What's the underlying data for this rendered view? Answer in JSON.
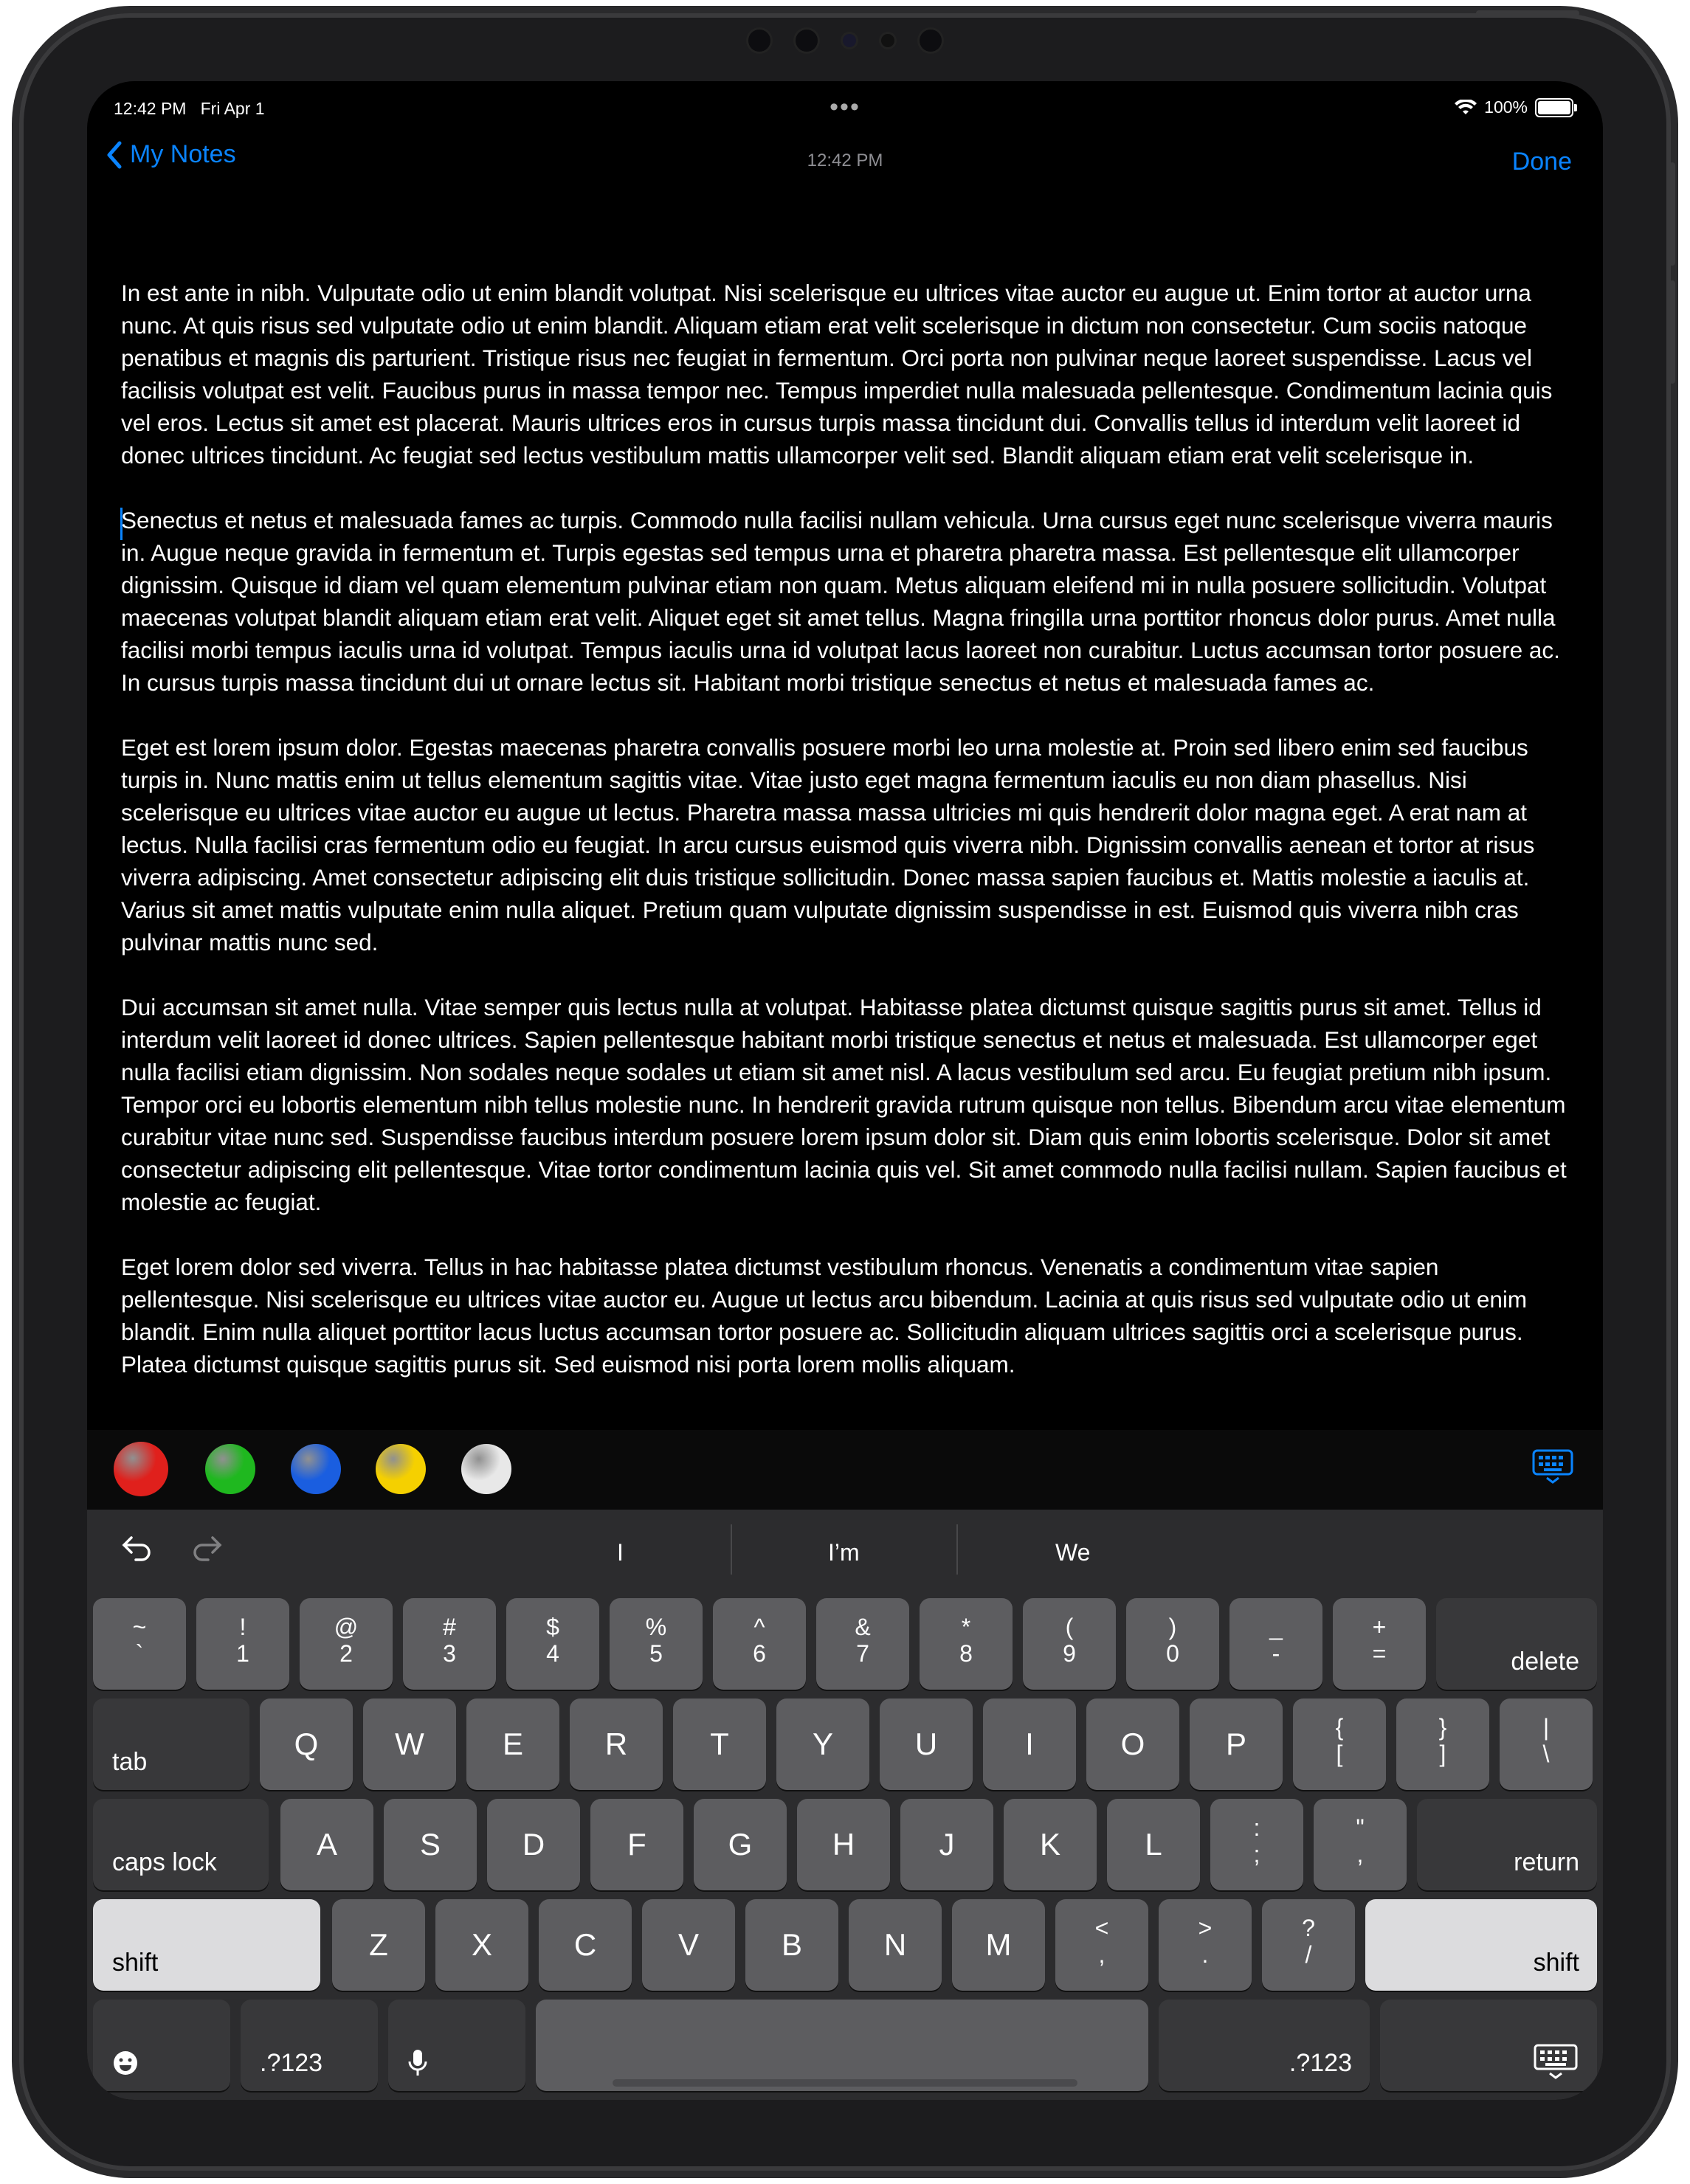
{
  "status_bar": {
    "time": "12:42 PM",
    "date": "Fri Apr 1",
    "battery": "100%",
    "icons": [
      "wifi-icon",
      "battery-icon"
    ]
  },
  "nav": {
    "back_label": "My Notes",
    "center_time": "12:42 PM",
    "done_label": "Done"
  },
  "note": {
    "paragraphs": [
      "In est ante in nibh. Vulputate odio ut enim blandit volutpat. Nisi scelerisque eu ultrices vitae auctor eu augue ut. Enim tortor at auctor urna nunc. At quis risus sed vulputate odio ut enim blandit. Aliquam etiam erat velit scelerisque in dictum non consectetur. Cum sociis natoque penatibus et magnis dis parturient. Tristique risus nec feugiat in fermentum. Orci porta non pulvinar neque laoreet suspendisse. Lacus vel facilisis volutpat est velit. Faucibus purus in massa tempor nec. Tempus imperdiet nulla malesuada pellentesque. Condimentum lacinia quis vel eros. Lectus sit amet est placerat. Mauris ultrices eros in cursus turpis massa tincidunt dui. Convallis tellus id interdum velit laoreet id donec ultrices tincidunt. Ac feugiat sed lectus vestibulum mattis ullamcorper velit sed. Blandit aliquam etiam erat velit scelerisque in.",
      "Senectus et netus et malesuada fames ac turpis. Commodo nulla facilisi nullam vehicula. Urna cursus eget nunc scelerisque viverra mauris in. Augue neque gravida in fermentum et. Turpis egestas sed tempus urna et pharetra pharetra massa. Est pellentesque elit ullamcorper dignissim. Quisque id diam vel quam elementum pulvinar etiam non quam. Metus aliquam eleifend mi in nulla posuere sollicitudin. Volutpat maecenas volutpat blandit aliquam etiam erat velit. Aliquet eget sit amet tellus. Magna fringilla urna porttitor rhoncus dolor purus. Amet nulla facilisi morbi tempus iaculis urna id volutpat. Tempus iaculis urna id volutpat lacus laoreet non curabitur. Luctus accumsan tortor posuere ac. In cursus turpis massa tincidunt dui ut ornare lectus sit. Habitant morbi tristique senectus et netus et malesuada fames ac.",
      "Eget est lorem ipsum dolor. Egestas maecenas pharetra convallis posuere morbi leo urna molestie at. Proin sed libero enim sed faucibus turpis in. Nunc mattis enim ut tellus elementum sagittis vitae. Vitae justo eget magna fermentum iaculis eu non diam phasellus. Nisi scelerisque eu ultrices vitae auctor eu augue ut lectus. Pharetra massa massa ultricies mi quis hendrerit dolor magna eget. A erat nam at lectus. Nulla facilisi cras fermentum odio eu feugiat. In arcu cursus euismod quis viverra nibh. Dignissim convallis aenean et tortor at risus viverra adipiscing. Amet consectetur adipiscing elit duis tristique sollicitudin. Donec massa sapien faucibus et. Mattis molestie a iaculis at. Varius sit amet mattis vulputate enim nulla aliquet. Pretium quam vulputate dignissim suspendisse in est. Euismod quis viverra nibh cras pulvinar mattis nunc sed.",
      "Dui accumsan sit amet nulla. Vitae semper quis lectus nulla at volutpat. Habitasse platea dictumst quisque sagittis purus sit amet. Tellus id interdum velit laoreet id donec ultrices. Sapien pellentesque habitant morbi tristique senectus et netus et malesuada. Est ullamcorper eget nulla facilisi etiam dignissim. Non sodales neque sodales ut etiam sit amet nisl. A lacus vestibulum sed arcu. Eu feugiat pretium nibh ipsum. Tempor orci eu lobortis elementum nibh tellus molestie nunc. In hendrerit gravida rutrum quisque non tellus. Bibendum arcu vitae elementum curabitur vitae nunc sed. Suspendisse faucibus interdum posuere lorem ipsum dolor sit. Diam quis enim lobortis scelerisque. Dolor sit amet consectetur adipiscing elit pellentesque. Vitae tortor condimentum lacinia quis vel. Sit amet commodo nulla facilisi nullam. Sapien faucibus et molestie ac feugiat.",
      "Eget lorem dolor sed viverra. Tellus in hac habitasse platea dictumst vestibulum rhoncus. Venenatis a condimentum vitae sapien pellentesque. Nisi scelerisque eu ultrices vitae auctor eu. Augue ut lectus arcu bibendum. Lacinia at quis risus sed vulputate odio ut enim blandit. Enim nulla aliquet porttitor lacus luctus accumsan tortor posuere ac. Sollicitudin aliquam ultrices sagittis orci a scelerisque purus. Platea dictumst quisque sagittis purus sit. Sed euismod nisi porta lorem mollis aliquam."
    ]
  },
  "colors": [
    "#e0201c",
    "#1fb81f",
    "#1a5ee0",
    "#f5d000",
    "#e8e8e8"
  ],
  "predictive": {
    "undo_icon": "undo-icon",
    "redo_icon": "redo-icon",
    "suggestions": [
      "I",
      "I’m",
      "We"
    ]
  },
  "keyboard": {
    "row1": [
      {
        "top": "~",
        "bottom": "`"
      },
      {
        "top": "!",
        "bottom": "1"
      },
      {
        "top": "@",
        "bottom": "2"
      },
      {
        "top": "#",
        "bottom": "3"
      },
      {
        "top": "$",
        "bottom": "4"
      },
      {
        "top": "%",
        "bottom": "5"
      },
      {
        "top": "^",
        "bottom": "6"
      },
      {
        "top": "&",
        "bottom": "7"
      },
      {
        "top": "*",
        "bottom": "8"
      },
      {
        "top": "(",
        "bottom": "9"
      },
      {
        "top": ")",
        "bottom": "0"
      },
      {
        "top": "_",
        "bottom": "-"
      },
      {
        "top": "+",
        "bottom": "="
      }
    ],
    "delete": "delete",
    "tab": "tab",
    "row2": [
      "Q",
      "W",
      "E",
      "R",
      "T",
      "Y",
      "U",
      "I",
      "O",
      "P"
    ],
    "row2_sym": [
      {
        "top": "{",
        "bottom": "["
      },
      {
        "top": "}",
        "bottom": "]"
      },
      {
        "top": "|",
        "bottom": "\\"
      }
    ],
    "caps": "caps lock",
    "row3": [
      "A",
      "S",
      "D",
      "F",
      "G",
      "H",
      "J",
      "K",
      "L"
    ],
    "row3_sym": [
      {
        "top": ":",
        "bottom": ";"
      },
      {
        "top": "\"",
        "bottom": ","
      }
    ],
    "return": "return",
    "shift": "shift",
    "row4": [
      "Z",
      "X",
      "C",
      "V",
      "B",
      "N",
      "M"
    ],
    "row4_sym": [
      {
        "top": "<",
        "bottom": ","
      },
      {
        "top": ">",
        "bottom": "."
      },
      {
        "top": "?",
        "bottom": "/"
      }
    ],
    "numbers": ".?123",
    "emoji_icon": "emoji-icon",
    "mic_icon": "microphone-icon",
    "dismiss_icon": "keyboard-dismiss-icon"
  }
}
